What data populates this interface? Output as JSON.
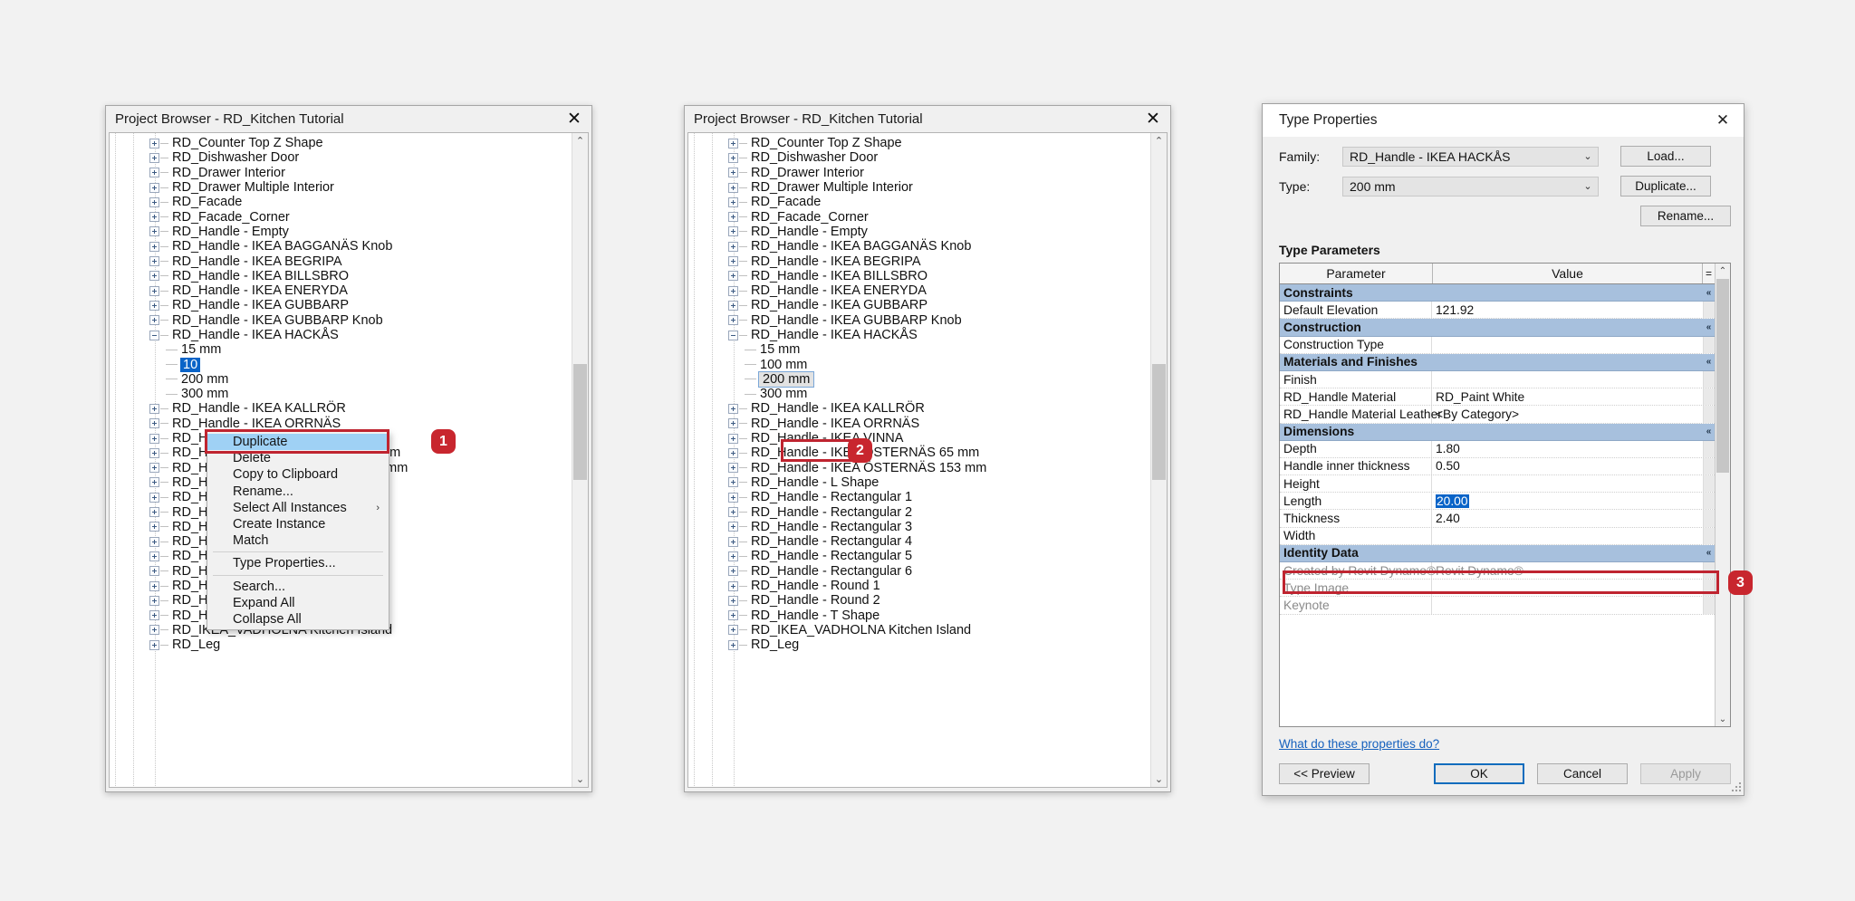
{
  "browser_title": "Project Browser - RD_Kitchen Tutorial",
  "close_glyph": "✕",
  "chev_up": "⌃",
  "chev_down": "⌄",
  "submenu_arrow": "›",
  "collapse_glyph": "«",
  "tree_top": [
    {
      "label": "RD_Counter Top Z Shape",
      "type": "branch"
    },
    {
      "label": "RD_Dishwasher Door",
      "type": "branch"
    },
    {
      "label": "RD_Drawer Interior",
      "type": "branch"
    },
    {
      "label": "RD_Drawer Multiple Interior",
      "type": "branch"
    },
    {
      "label": "RD_Facade",
      "type": "branch"
    },
    {
      "label": "RD_Facade_Corner",
      "type": "branch"
    },
    {
      "label": "RD_Handle - Empty",
      "type": "branch"
    },
    {
      "label": "RD_Handle - IKEA BAGGANÄS Knob",
      "type": "branch"
    },
    {
      "label": "RD_Handle - IKEA BEGRIPA",
      "type": "branch"
    },
    {
      "label": "RD_Handle - IKEA BILLSBRO",
      "type": "branch"
    },
    {
      "label": "RD_Handle - IKEA ENERYDA",
      "type": "branch"
    },
    {
      "label": "RD_Handle - IKEA GUBBARP",
      "type": "branch"
    },
    {
      "label": "RD_Handle - IKEA GUBBARP Knob",
      "type": "branch"
    },
    {
      "label": "RD_Handle - IKEA HACKÅS",
      "type": "expanded"
    }
  ],
  "hackas_children": [
    "15 mm",
    "100 mm",
    "200 mm",
    "300 mm"
  ],
  "tree_bottom": [
    {
      "label": "RD_Handle - IKEA KALLRÖR",
      "type": "branch"
    },
    {
      "label": "RD_Handle - IKEA ORRNÄS",
      "type": "branch"
    },
    {
      "label": "RD_Handle - IKEA VINNA",
      "type": "branch"
    },
    {
      "label": "RD_Handle - IKEA ÖSTERNÄS 65 mm",
      "type": "branch"
    },
    {
      "label": "RD_Handle - IKEA ÖSTERNÄS 153 mm",
      "type": "branch"
    },
    {
      "label": "RD_Handle - L Shape",
      "type": "branch"
    },
    {
      "label": "RD_Handle - Rectangular 1",
      "type": "branch"
    },
    {
      "label": "RD_Handle - Rectangular 2",
      "type": "branch"
    },
    {
      "label": "RD_Handle - Rectangular 3",
      "type": "branch"
    },
    {
      "label": "RD_Handle - Rectangular 4",
      "type": "branch"
    },
    {
      "label": "RD_Handle - Rectangular 5",
      "type": "branch"
    },
    {
      "label": "RD_Handle - Rectangular 6",
      "type": "branch"
    },
    {
      "label": "RD_Handle - Round 1",
      "type": "branch"
    },
    {
      "label": "RD_Handle - Round 2",
      "type": "branch"
    },
    {
      "label": "RD_Handle - T Shape",
      "type": "branch"
    },
    {
      "label": "RD_IKEA_VADHOLNA Kitchen Island",
      "type": "branch"
    },
    {
      "label": "RD_Leg",
      "type": "branch"
    }
  ],
  "panel1": {
    "selected_child": "100 mm",
    "selected_child_visible": "10"
  },
  "panel2": {
    "selected_child": "200 mm"
  },
  "context_menu": {
    "items": [
      {
        "label": "Duplicate",
        "highlighted": true,
        "submenu": false,
        "sep_after": false
      },
      {
        "label": "Delete",
        "highlighted": false,
        "submenu": false,
        "sep_after": false
      },
      {
        "label": "Copy to Clipboard",
        "highlighted": false,
        "submenu": false,
        "sep_after": false
      },
      {
        "label": "Rename...",
        "highlighted": false,
        "submenu": false,
        "sep_after": false
      },
      {
        "label": "Select All Instances",
        "highlighted": false,
        "submenu": true,
        "sep_after": false
      },
      {
        "label": "Create Instance",
        "highlighted": false,
        "submenu": false,
        "sep_after": false
      },
      {
        "label": "Match",
        "highlighted": false,
        "submenu": false,
        "sep_after": true
      },
      {
        "label": "Type Properties...",
        "highlighted": false,
        "submenu": false,
        "sep_after": true
      },
      {
        "label": "Search...",
        "highlighted": false,
        "submenu": false,
        "sep_after": false
      },
      {
        "label": "Expand All",
        "highlighted": false,
        "submenu": false,
        "sep_after": false
      },
      {
        "label": "Collapse All",
        "highlighted": false,
        "submenu": false,
        "sep_after": false
      }
    ]
  },
  "type_properties": {
    "title": "Type Properties",
    "family_label": "Family:",
    "family_value": "RD_Handle - IKEA HACKÅS",
    "type_label": "Type:",
    "type_value": "200 mm",
    "load_button": "Load...",
    "duplicate_button": "Duplicate...",
    "rename_button": "Rename...",
    "type_parameters_label": "Type Parameters",
    "col_parameter": "Parameter",
    "col_value": "Value",
    "col_equals": "=",
    "rows": [
      {
        "kind": "group",
        "parameter": "Constraints",
        "value": ""
      },
      {
        "kind": "row",
        "parameter": "Default Elevation",
        "value": "121.92"
      },
      {
        "kind": "group",
        "parameter": "Construction",
        "value": ""
      },
      {
        "kind": "row",
        "parameter": "Construction Type",
        "value": ""
      },
      {
        "kind": "group",
        "parameter": "Materials and Finishes",
        "value": ""
      },
      {
        "kind": "row",
        "parameter": "Finish",
        "value": ""
      },
      {
        "kind": "row",
        "parameter": "RD_Handle Material",
        "value": "RD_Paint White"
      },
      {
        "kind": "row",
        "parameter": "RD_Handle Material Leather",
        "value": "<By Category>"
      },
      {
        "kind": "group",
        "parameter": "Dimensions",
        "value": ""
      },
      {
        "kind": "row",
        "parameter": "Depth",
        "value": "1.80"
      },
      {
        "kind": "row",
        "parameter": "Handle inner thickness",
        "value": "0.50"
      },
      {
        "kind": "row",
        "parameter": "Height",
        "value": ""
      },
      {
        "kind": "row",
        "parameter": "Length",
        "value": "20.00",
        "editing": true
      },
      {
        "kind": "row",
        "parameter": "Thickness",
        "value": "2.40"
      },
      {
        "kind": "row",
        "parameter": "Width",
        "value": ""
      },
      {
        "kind": "group",
        "parameter": "Identity Data",
        "value": ""
      },
      {
        "kind": "row",
        "parameter": "Created by Revit Dynamo®",
        "value": "Revit Dynamo®",
        "dim": true
      },
      {
        "kind": "row",
        "parameter": "Type Image",
        "value": "",
        "dim": true
      },
      {
        "kind": "row",
        "parameter": "Keynote",
        "value": "",
        "dim": true
      }
    ],
    "help_link": "What do these properties do?",
    "preview_button": "<< Preview",
    "ok_button": "OK",
    "cancel_button": "Cancel",
    "apply_button": "Apply"
  },
  "callouts": [
    {
      "number": "1"
    },
    {
      "number": "2"
    },
    {
      "number": "3"
    }
  ],
  "colors": {
    "accent_red": "#c8262e",
    "selection_blue": "#0a64c8",
    "group_header_blue": "#a7c0dd",
    "menu_highlight": "#9fd1f5",
    "link_blue": "#1560bd"
  }
}
